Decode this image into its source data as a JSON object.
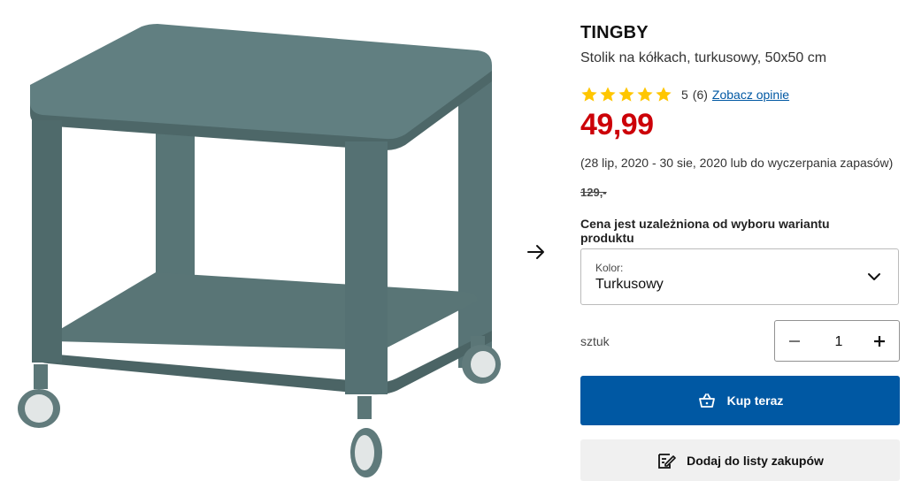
{
  "product": {
    "name": "TINGBY",
    "description": "Stolik na kółkach, turkusowy, 50x50 cm",
    "rating_value": "5",
    "rating_count": "(6)",
    "stars_filled": 5,
    "reviews_link": "Zobacz opinie",
    "price": "49,99",
    "price_color": "#cc0008",
    "offer_dates": "(28 lip, 2020 - 30 sie, 2020 lub do wyczerpania zapasów)",
    "old_price": "129,-",
    "variant_note": "Cena jest uzależniona od wyboru wariantu produktu"
  },
  "color_select": {
    "label": "Kolor:",
    "value": "Turkusowy"
  },
  "quantity": {
    "label": "sztuk",
    "value": "1",
    "minus_icon": "minus-icon",
    "plus_icon": "plus-icon"
  },
  "actions": {
    "buy_label": "Kup teraz",
    "buy_color": "#0058a3",
    "list_label": "Dodaj do listy zakupów"
  },
  "icons": {
    "next_image": "arrow-right-icon",
    "select_chevron": "chevron-down-icon",
    "cart": "shopping-bag-icon",
    "list": "edit-list-icon",
    "star_color": "#ffc600"
  }
}
